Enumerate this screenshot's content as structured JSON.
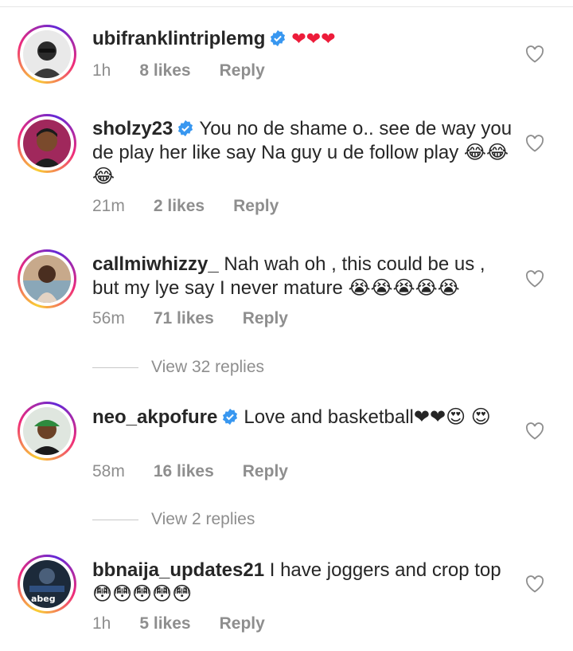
{
  "comments": [
    {
      "username": "ubifranklintriplemg",
      "verified": true,
      "text": "❤❤❤",
      "time": "1h",
      "likes": "8 likes",
      "reply": "Reply"
    },
    {
      "username": "sholzy23",
      "verified": true,
      "text": "You no de shame o.. see de way you de play her like say Na guy u de follow play 😂😂😂",
      "time": "21m",
      "likes": "2 likes",
      "reply": "Reply"
    },
    {
      "username": "callmiwhizzy_",
      "verified": false,
      "text": "Nah wah oh , this could be us , but my lye say I never mature 😭😭😭😭😭",
      "time": "56m",
      "likes": "71 likes",
      "reply": "Reply",
      "view_replies": "View 32 replies"
    },
    {
      "username": "neo_akpofure",
      "verified": true,
      "text": "Love and basketball❤❤😍 😍",
      "time": "58m",
      "likes": "16 likes",
      "reply": "Reply",
      "view_replies": "View 2 replies"
    },
    {
      "username": "bbnaija_updates21",
      "verified": false,
      "text": "I have joggers and crop top 😳😳😳😳😳",
      "time": "1h",
      "likes": "5 likes",
      "reply": "Reply"
    }
  ],
  "avatar_logo_text": "abeg",
  "colors": {
    "verified_blue": "#3897f0",
    "meta_gray": "#8e8e8e",
    "text_dark": "#262626",
    "heart_red": "#ed1c3a"
  }
}
